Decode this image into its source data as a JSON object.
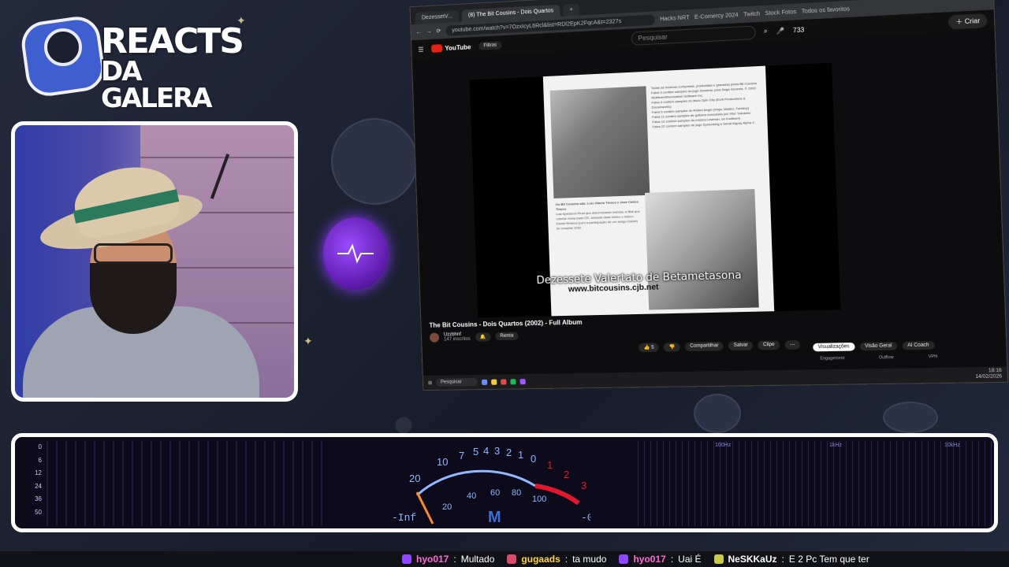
{
  "logo": {
    "line1": "REACTS",
    "line2": "DA GALERA"
  },
  "browser": {
    "tabs": [
      {
        "label": "DezessetV..."
      },
      {
        "label": "(8) The Bit Cousins - Dois Quartos",
        "active": true
      },
      {
        "label": "+"
      }
    ],
    "url": "youtube.com/watch?v=7OzxIcyL6Rcl&list=RDl2EpK2FqcA&t=2327s",
    "bookmarks": [
      "Hacks NRT",
      "E-Comercy 2024",
      "Twitch",
      "Stock Fotos",
      "Todos os favoritos"
    ],
    "toolbar_count": "733"
  },
  "youtube": {
    "logo": "YouTube",
    "filter_label": "Filtros",
    "search_placeholder": "Pesquisar",
    "create_label": "Criar",
    "video_title": "The Bit Cousins - Dois Quartos (2002) - Full Album",
    "channel": "Uzzbhnf",
    "subscribers": "147 inscritos",
    "remix_label": "Remix",
    "likes": "5",
    "actions": [
      "Compartilhar",
      "Salvar",
      "Clipe"
    ],
    "side_tabs": [
      "Visualizações",
      "Visão Geral",
      "AI Coach"
    ],
    "side_sub": [
      "Engagement",
      "Outflow",
      "VPH"
    ]
  },
  "album_page": {
    "site": "www.bitcousins.cjb.net",
    "caption_head": "Os Bit Cousins são: Luiz Otávio Tinoco e José Carlos Tinoco",
    "credits": [
      "Todas as músicas compostas, produzidas e gravadas pelos Bit Cousins",
      "Faixa 3 contém samples do jogo Sewavia, para Sega Genesis, © 1993 Wolfteam/Renovation Software Inc.",
      "Faixa 4 contém samples do disco Spin City (EUA Productions & Dreamworks)",
      "Faixa 6 contém samples de Rafael Angel (Virgo, Madeo, Fantasy)",
      "Faixa 11 contém samples de guitarra executada por Vitor Toledano",
      "Faixa 12 contém samples da música Lowman, do Kraftwerk",
      "Faixa 22 contém samples do jogo Spelunking e Senal Kigray Alpha 2"
    ],
    "caption_body": "Luiz Apesterra Pinal que determinasse mandar, a filial que unemia nesta base CD, amanda dade inteiro o marco Daniel Rebeca (com a participação de um amigo Daniel) de compilar 2002."
  },
  "overlay_text": "Dezessete Valertato de Betametasona",
  "taskbar": {
    "search": "Pesquisar",
    "time": "18:16",
    "date": "14/02/2026"
  },
  "meter": {
    "scale": [
      "0",
      "6",
      "12",
      "24",
      "36",
      "50"
    ],
    "gauge_top": [
      "20",
      "10",
      "7",
      "5",
      "4",
      "3",
      "2",
      "1",
      "0",
      "1",
      "2",
      "3"
    ],
    "gauge_bottom": [
      "20",
      "40",
      "60",
      "80",
      "100"
    ],
    "left_value": "-Inf",
    "center_label": "M",
    "right_value": "-0.6",
    "freqs": [
      "100Hz",
      "1kHz",
      "10kHz"
    ],
    "colors": {
      "scale": "#8fb8ff",
      "red": "#e0182a",
      "needle": "#ff8a2a"
    }
  },
  "chat": [
    {
      "user": "hyo017",
      "msg": "Multado",
      "color": "#ff6ad5"
    },
    {
      "user": "gugaads",
      "msg": "ta mudo",
      "color": "#ffd23c"
    },
    {
      "user": "hyo017",
      "msg": "Uai  É",
      "color": "#ff6ad5"
    },
    {
      "user": "NeSKKaUz",
      "msg": "E 2 Pc  Tem que ter",
      "color": "#ffffff"
    }
  ]
}
